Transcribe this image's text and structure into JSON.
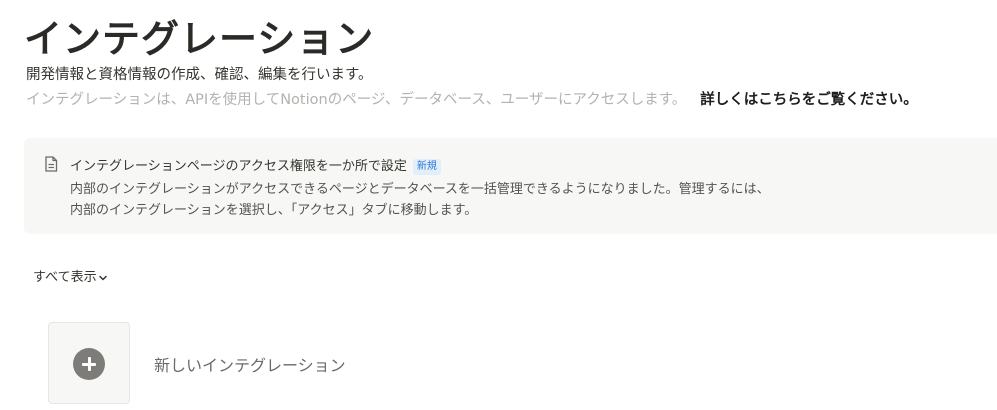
{
  "header": {
    "title": "インテグレーション",
    "subtitle": "開発情報と資格情報の作成、確認、編集を行います。",
    "description": "インテグレーションは、APIを使用してNotionのページ、データベース、ユーザーにアクセスします。",
    "learn_more": "詳しくはこちらをご覧ください。"
  },
  "callout": {
    "icon": "document-icon",
    "title": "インテグレーションページのアクセス権限を一か所で設定",
    "badge": "新規",
    "body_line1": "内部のインテグレーションがアクセスできるページとデータベースを一括管理できるようになりました。管理するには、",
    "body_line2": "内部のインテグレーションを選択し、「アクセス」タブに移動します。"
  },
  "filter": {
    "label": "すべて表示",
    "icon": "chevron-down-icon"
  },
  "new_integration": {
    "icon": "plus-circle-icon",
    "label": "新しいインテグレーション"
  }
}
